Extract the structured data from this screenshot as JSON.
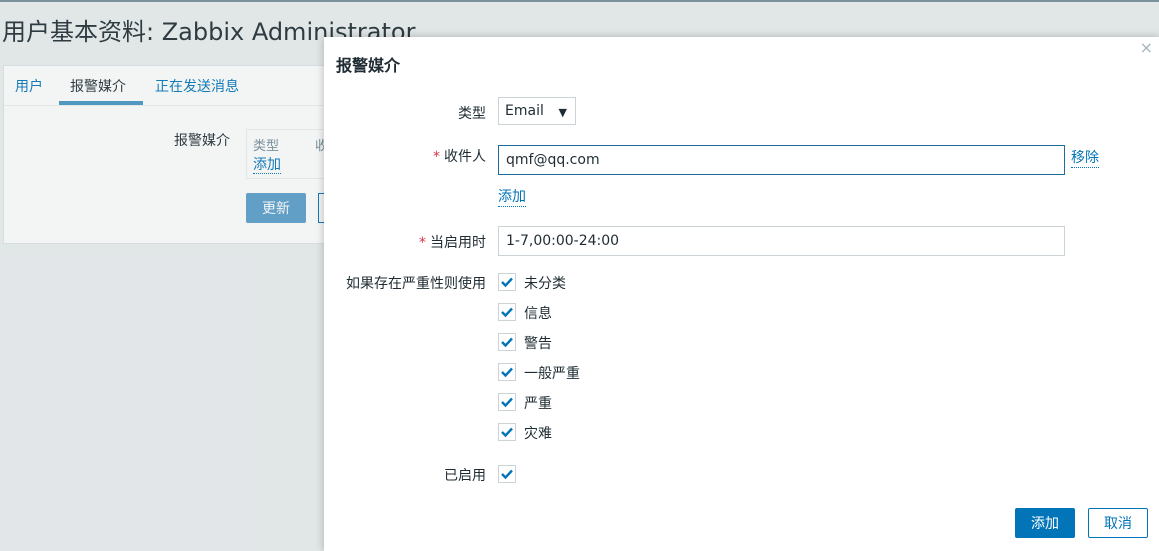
{
  "page": {
    "title": "用户基本资料: Zabbix Administrator",
    "tabs": [
      {
        "label": "用户"
      },
      {
        "label": "报警媒介"
      },
      {
        "label": "正在发送消息"
      }
    ],
    "media_label": "报警媒介",
    "media_table_headers": {
      "type": "类型",
      "recipient": "收"
    },
    "add_link": "添加",
    "update_button": "更新"
  },
  "dialog": {
    "title": "报警媒介",
    "close_symbol": "×",
    "type_label": "类型",
    "type_value": "Email",
    "type_arrow": "▼",
    "recipient_label": "收件人",
    "recipient_value": "qmf@qq.com",
    "remove_link": "移除",
    "add_link": "添加",
    "when_active_label": "当启用时",
    "when_active_value": "1-7,00:00-24:00",
    "severity_label": "如果存在严重性则使用",
    "severities": [
      {
        "label": "未分类",
        "checked": true
      },
      {
        "label": "信息",
        "checked": true
      },
      {
        "label": "警告",
        "checked": true
      },
      {
        "label": "一般严重",
        "checked": true
      },
      {
        "label": "严重",
        "checked": true
      },
      {
        "label": "灾难",
        "checked": true
      }
    ],
    "enabled_label": "已启用",
    "enabled_checked": true,
    "add_button": "添加",
    "cancel_button": "取消",
    "required_mark": "*"
  },
  "colors": {
    "accent": "#0275b8",
    "check": "#0275b8",
    "required": "#dc3545"
  }
}
